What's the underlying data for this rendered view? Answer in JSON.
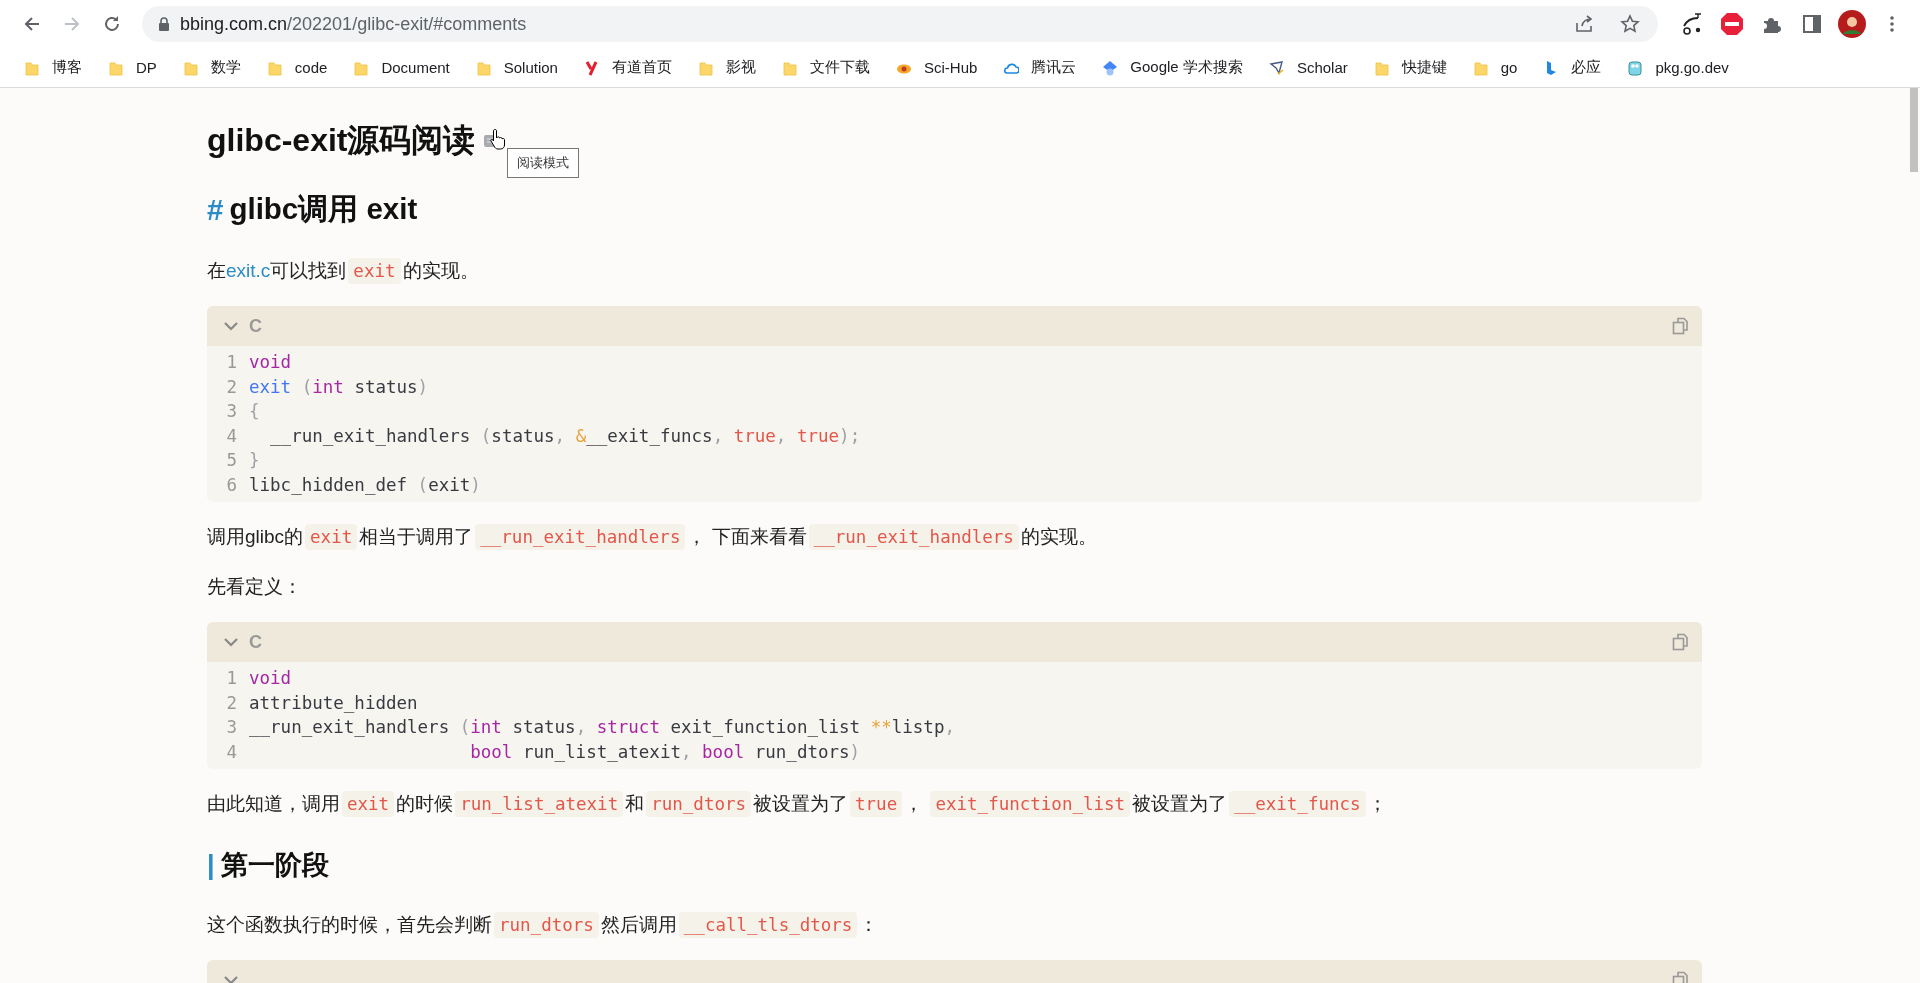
{
  "browser": {
    "url_host": "bbing.com.cn",
    "url_path": "/202201/glibc-exit/#comments",
    "forward_disabled": true,
    "bookmarks": [
      {
        "label": "博客",
        "kind": "folder"
      },
      {
        "label": "DP",
        "kind": "folder"
      },
      {
        "label": "数学",
        "kind": "folder"
      },
      {
        "label": "code",
        "kind": "folder"
      },
      {
        "label": "Document",
        "kind": "folder"
      },
      {
        "label": "Solution",
        "kind": "folder"
      },
      {
        "label": "有道首页",
        "kind": "youdao"
      },
      {
        "label": "影视",
        "kind": "folder"
      },
      {
        "label": "文件下载",
        "kind": "folder"
      },
      {
        "label": "Sci-Hub",
        "kind": "scihub"
      },
      {
        "label": "腾讯云",
        "kind": "cloud"
      },
      {
        "label": "Google 学术搜索",
        "kind": "cap"
      },
      {
        "label": "Scholar",
        "kind": "scholar"
      },
      {
        "label": "快捷键",
        "kind": "folder"
      },
      {
        "label": "go",
        "kind": "folder"
      },
      {
        "label": "必应",
        "kind": "bing"
      },
      {
        "label": "pkg.go.dev",
        "kind": "gopher"
      }
    ]
  },
  "article": {
    "blocks": [
      {
        "kind": "title",
        "text": "glibc-exit源码阅读",
        "tooltip": "阅读模式"
      },
      {
        "kind": "h2",
        "marker": "#",
        "text": "glibc调用 exit"
      },
      {
        "kind": "paragraph",
        "segments": [
          {
            "kind": "text",
            "text": "在"
          },
          {
            "kind": "link",
            "text": "exit.c"
          },
          {
            "kind": "text",
            "text": "可以找到"
          },
          {
            "kind": "code",
            "text": "exit"
          },
          {
            "kind": "text",
            "text": "的实现。"
          }
        ]
      },
      {
        "kind": "code",
        "language": "C",
        "lines": [
          {
            "number": "1",
            "tokens": [
              {
                "kind": "kw",
                "text": "void"
              }
            ]
          },
          {
            "number": "2",
            "tokens": [
              {
                "kind": "fn",
                "text": "exit"
              },
              {
                "kind": "punct",
                "text": " ("
              },
              {
                "kind": "kw",
                "text": "int"
              },
              {
                "kind": "plain",
                "text": " status"
              },
              {
                "kind": "punct",
                "text": ")"
              }
            ]
          },
          {
            "number": "3",
            "tokens": [
              {
                "kind": "punct",
                "text": "{"
              }
            ]
          },
          {
            "number": "4",
            "tokens": [
              {
                "kind": "plain",
                "text": "  __run_exit_handlers "
              },
              {
                "kind": "punct",
                "text": "("
              },
              {
                "kind": "plain",
                "text": "status"
              },
              {
                "kind": "punct",
                "text": ", "
              },
              {
                "kind": "op",
                "text": "&"
              },
              {
                "kind": "plain",
                "text": "__exit_funcs"
              },
              {
                "kind": "punct",
                "text": ", "
              },
              {
                "kind": "lit",
                "text": "true"
              },
              {
                "kind": "punct",
                "text": ", "
              },
              {
                "kind": "lit",
                "text": "true"
              },
              {
                "kind": "punct",
                "text": ");"
              }
            ]
          },
          {
            "number": "5",
            "tokens": [
              {
                "kind": "punct",
                "text": "}"
              }
            ]
          },
          {
            "number": "6",
            "tokens": [
              {
                "kind": "plain",
                "text": "libc_hidden_def "
              },
              {
                "kind": "punct",
                "text": "("
              },
              {
                "kind": "plain",
                "text": "exit"
              },
              {
                "kind": "punct",
                "text": ")"
              }
            ]
          }
        ]
      },
      {
        "kind": "paragraph",
        "segments": [
          {
            "kind": "text",
            "text": "调用glibc的"
          },
          {
            "kind": "code",
            "text": "exit"
          },
          {
            "kind": "text",
            "text": "相当于调用了"
          },
          {
            "kind": "code",
            "text": "__run_exit_handlers"
          },
          {
            "kind": "text",
            "text": "， 下面来看看"
          },
          {
            "kind": "code",
            "text": "__run_exit_handlers"
          },
          {
            "kind": "text",
            "text": "的实现。"
          }
        ]
      },
      {
        "kind": "paragraph",
        "segments": [
          {
            "kind": "text",
            "text": "先看定义："
          }
        ]
      },
      {
        "kind": "code",
        "language": "C",
        "lines": [
          {
            "number": "1",
            "tokens": [
              {
                "kind": "kw",
                "text": "void"
              }
            ]
          },
          {
            "number": "2",
            "tokens": [
              {
                "kind": "plain",
                "text": "attribute_hidden"
              }
            ]
          },
          {
            "number": "3",
            "tokens": [
              {
                "kind": "plain",
                "text": "__run_exit_handlers "
              },
              {
                "kind": "punct",
                "text": "("
              },
              {
                "kind": "kw",
                "text": "int"
              },
              {
                "kind": "plain",
                "text": " status"
              },
              {
                "kind": "punct",
                "text": ", "
              },
              {
                "kind": "kw",
                "text": "struct"
              },
              {
                "kind": "plain",
                "text": " exit_function_list "
              },
              {
                "kind": "op",
                "text": "**"
              },
              {
                "kind": "plain",
                "text": "listp"
              },
              {
                "kind": "punct",
                "text": ","
              }
            ]
          },
          {
            "number": "4",
            "tokens": [
              {
                "kind": "kw",
                "text": "                     bool"
              },
              {
                "kind": "plain",
                "text": " run_list_atexit"
              },
              {
                "kind": "punct",
                "text": ", "
              },
              {
                "kind": "kw",
                "text": "bool"
              },
              {
                "kind": "plain",
                "text": " run_dtors"
              },
              {
                "kind": "punct",
                "text": ")"
              }
            ]
          }
        ]
      },
      {
        "kind": "paragraph",
        "segments": [
          {
            "kind": "text",
            "text": "由此知道，调用"
          },
          {
            "kind": "code",
            "text": "exit"
          },
          {
            "kind": "text",
            "text": "的时候"
          },
          {
            "kind": "code",
            "text": "run_list_atexit"
          },
          {
            "kind": "text",
            "text": "和"
          },
          {
            "kind": "code",
            "text": "run_dtors"
          },
          {
            "kind": "text",
            "text": "被设置为了"
          },
          {
            "kind": "code",
            "text": "true"
          },
          {
            "kind": "text",
            "text": "， "
          },
          {
            "kind": "code",
            "text": "exit_function_list"
          },
          {
            "kind": "text",
            "text": "被设置为了"
          },
          {
            "kind": "code",
            "text": "__exit_funcs"
          },
          {
            "kind": "text",
            "text": "；"
          }
        ]
      },
      {
        "kind": "h3",
        "marker": "|",
        "text": "第一阶段"
      },
      {
        "kind": "paragraph",
        "segments": [
          {
            "kind": "text",
            "text": "这个函数执行的时候，首先会判断"
          },
          {
            "kind": "code",
            "text": "run_dtors"
          },
          {
            "kind": "text",
            "text": "然后调用"
          },
          {
            "kind": "code",
            "text": "__call_tls_dtors"
          },
          {
            "kind": "text",
            "text": "："
          }
        ]
      },
      {
        "kind": "code"
      }
    ]
  }
}
